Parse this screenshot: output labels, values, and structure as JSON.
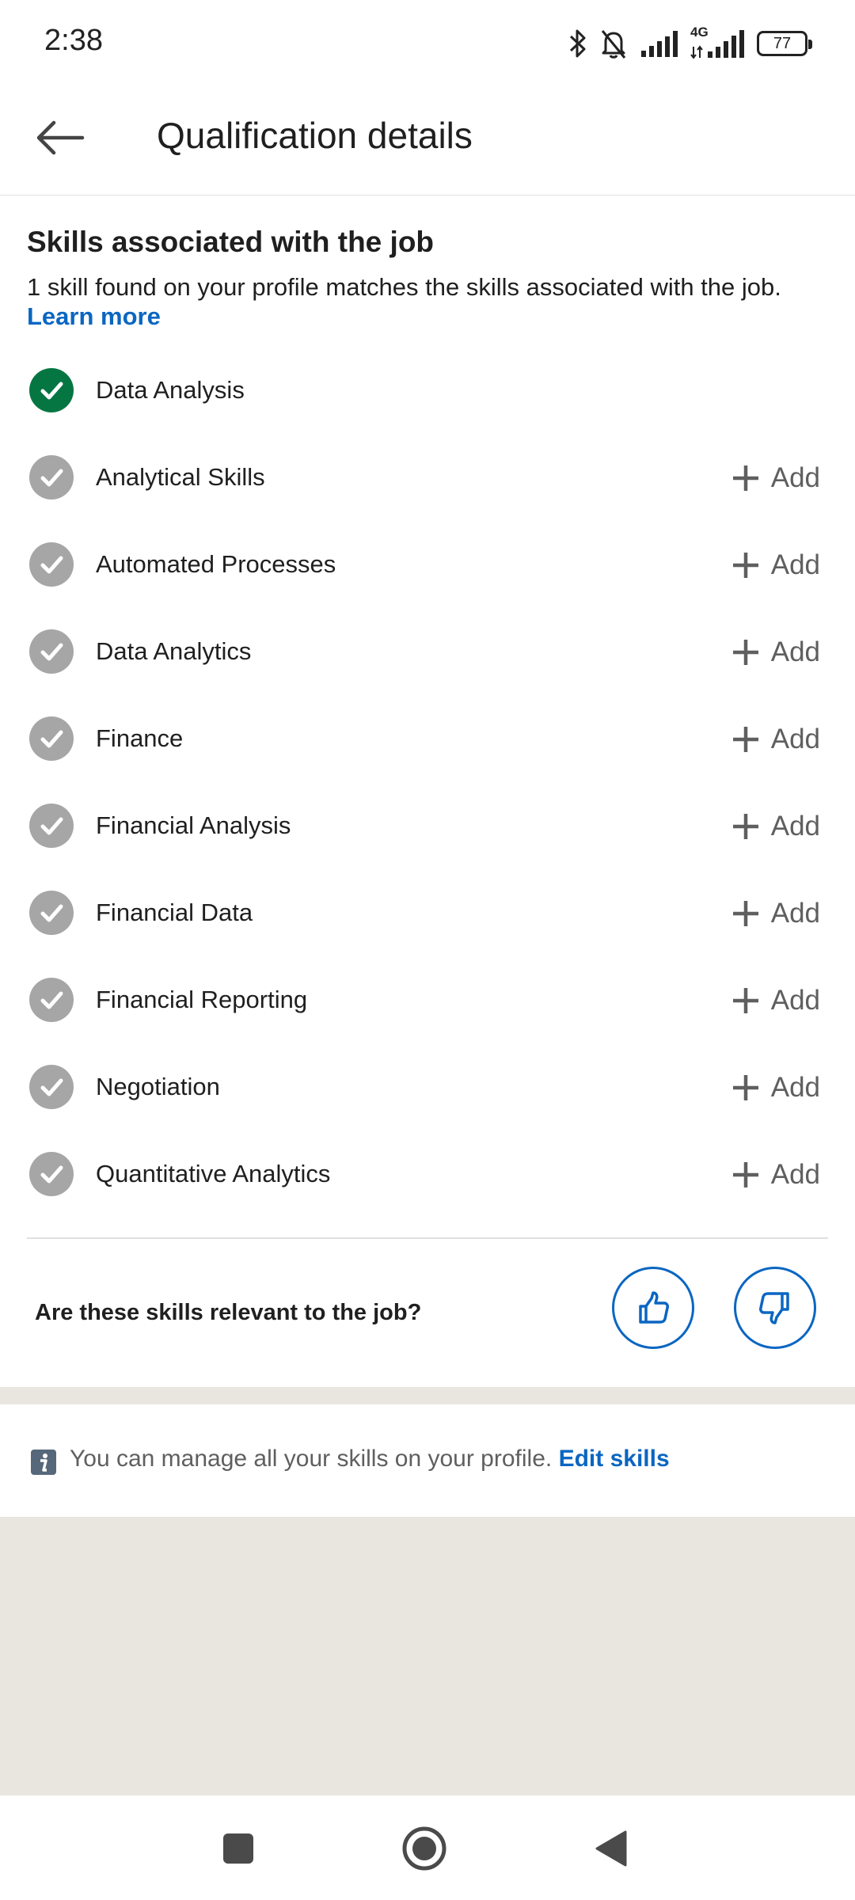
{
  "status_bar": {
    "time": "2:38",
    "network_label": "4G",
    "battery": "77",
    "icons": [
      "bluetooth-icon",
      "bell-muted-icon",
      "signal-icon",
      "signal-4g-icon",
      "battery-icon"
    ]
  },
  "app_bar": {
    "title": "Qualification details",
    "back_icon": "arrow-left-icon"
  },
  "skills_section": {
    "heading": "Skills associated with the job",
    "description": "1 skill found on your profile matches the skills associated with the job.",
    "learn_more": "Learn more",
    "add_label": "Add",
    "skills": [
      {
        "name": "Data Analysis",
        "matched": true
      },
      {
        "name": "Analytical Skills",
        "matched": false
      },
      {
        "name": "Automated Processes",
        "matched": false
      },
      {
        "name": "Data Analytics",
        "matched": false
      },
      {
        "name": "Finance",
        "matched": false
      },
      {
        "name": "Financial Analysis",
        "matched": false
      },
      {
        "name": "Financial Data",
        "matched": false
      },
      {
        "name": "Financial Reporting",
        "matched": false
      },
      {
        "name": "Negotiation",
        "matched": false
      },
      {
        "name": "Quantitative Analytics",
        "matched": false
      }
    ]
  },
  "feedback": {
    "question": "Are these skills relevant to the job?",
    "thumbs_up_icon": "thumbs-up-icon",
    "thumbs_down_icon": "thumbs-down-icon"
  },
  "info": {
    "text": "You can manage all your skills on your profile.",
    "link": "Edit skills",
    "icon": "info-icon"
  },
  "colors": {
    "accent": "#0a66c2",
    "matched": "#057642",
    "unmatched": "#a6a6a6",
    "background_gray": "#e9e6df"
  }
}
